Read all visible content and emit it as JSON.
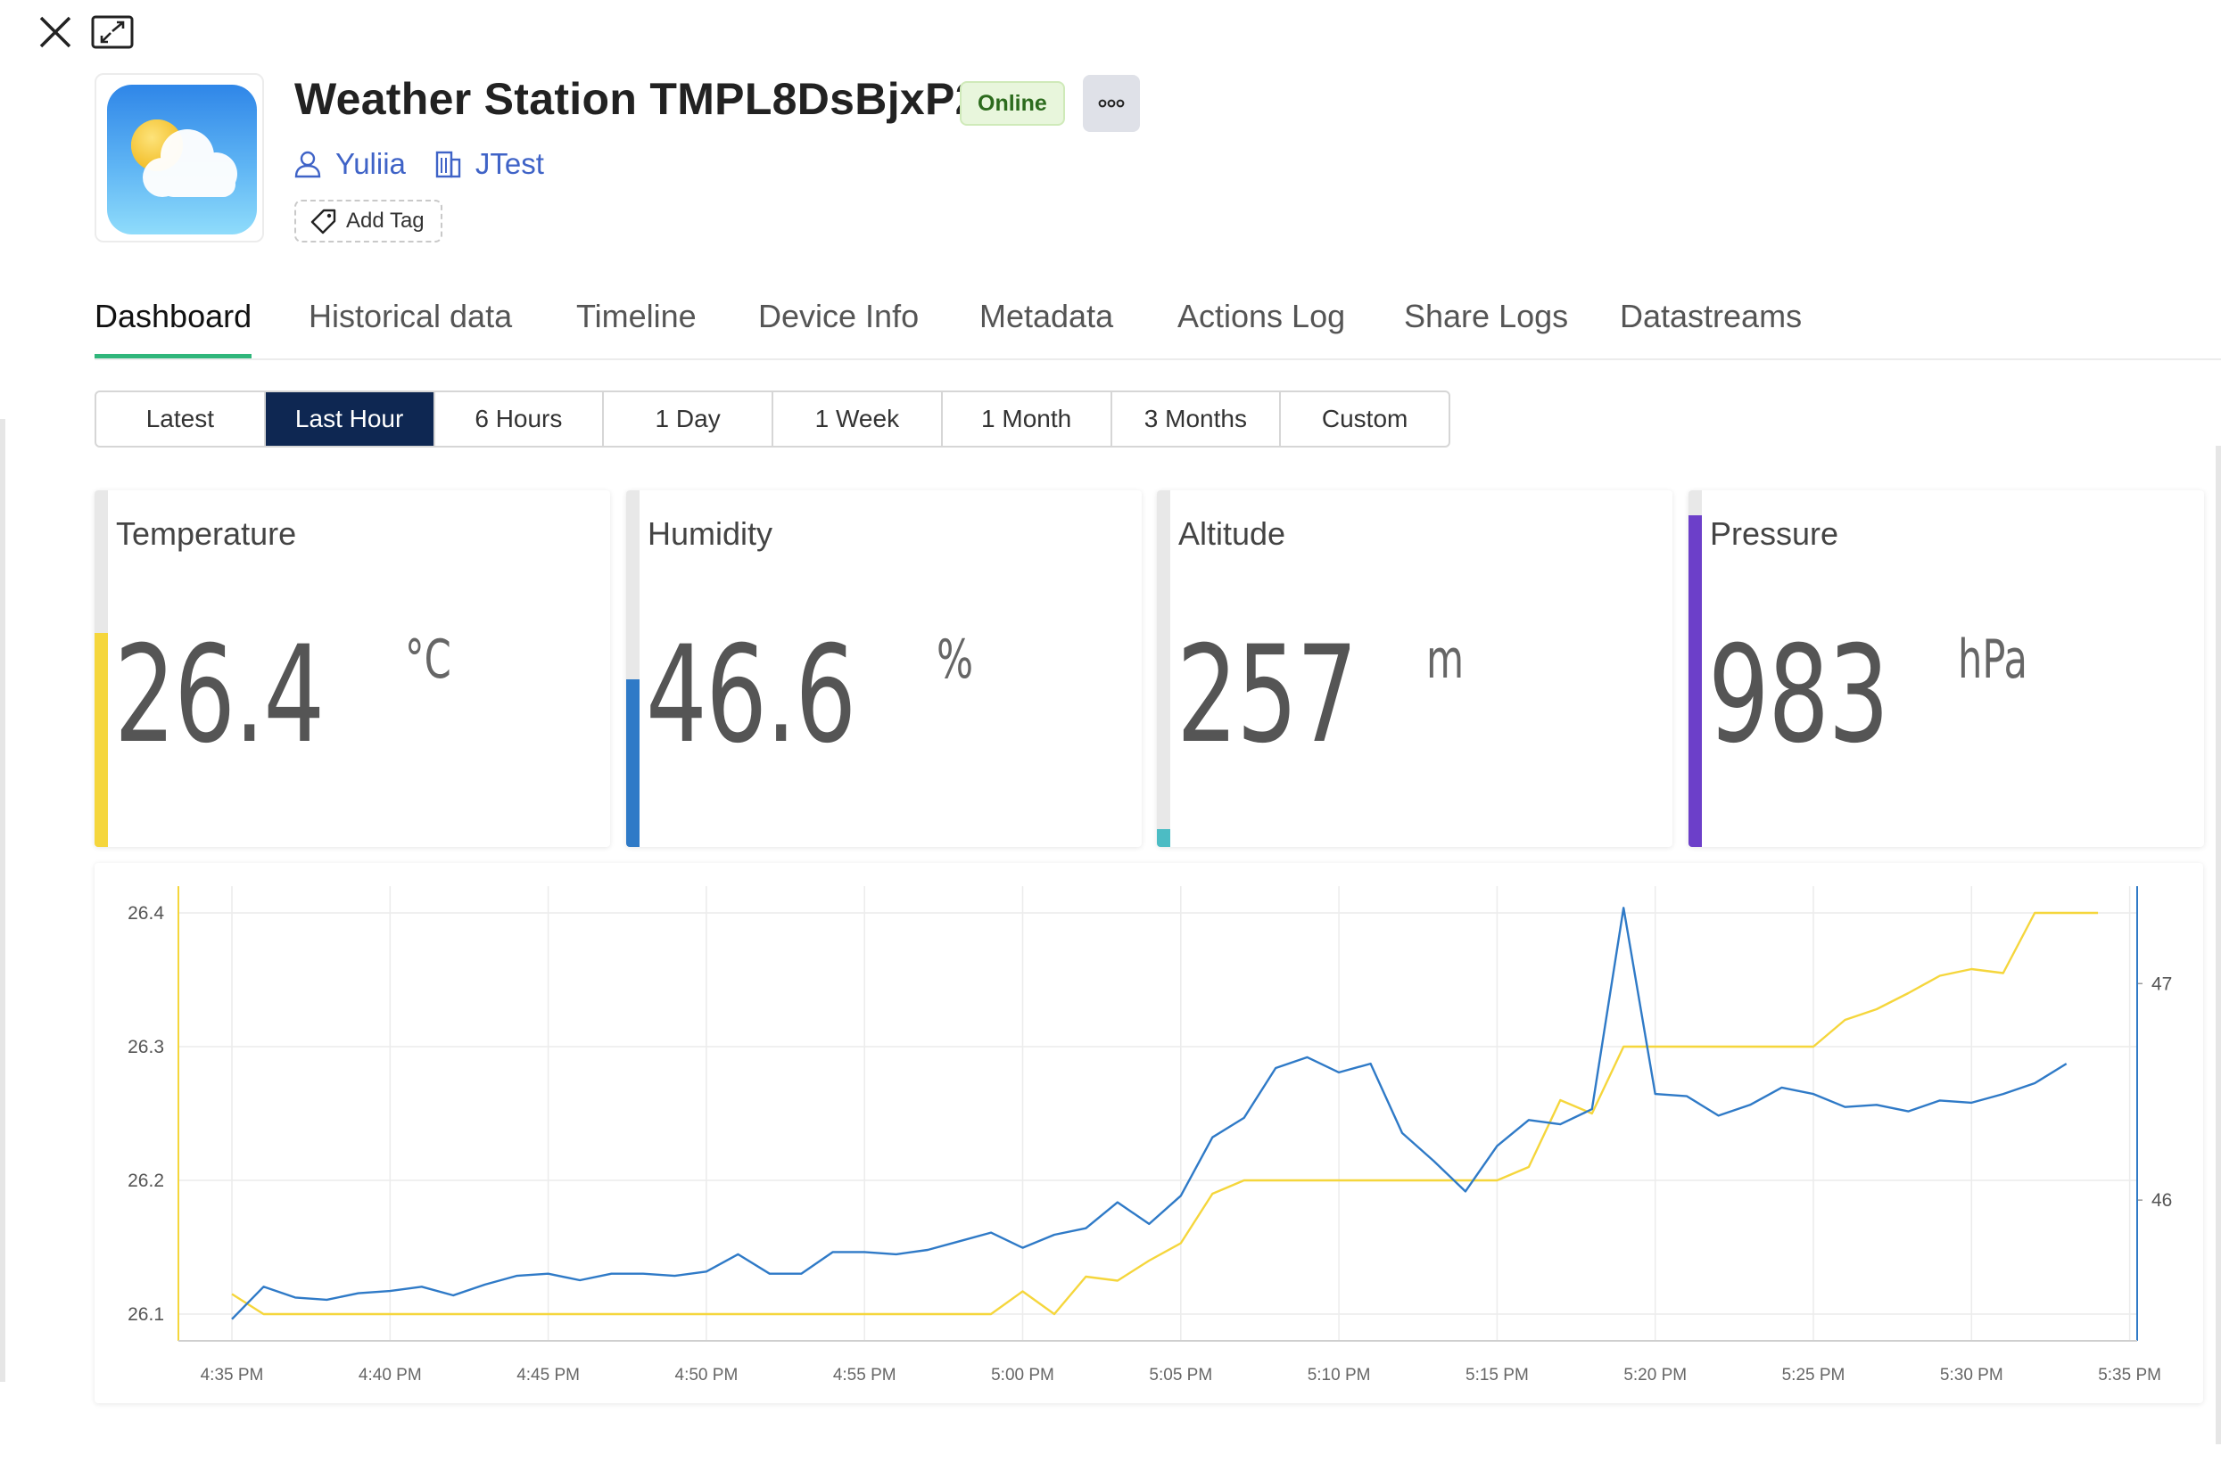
{
  "device": {
    "title": "Weather Station TMPL8DsBjxP2",
    "status": "Online",
    "owner": "Yuliia",
    "organization": "JTest",
    "add_tag_label": "Add Tag",
    "image_icon": "sun-cloud-icon"
  },
  "tabs": [
    "Dashboard",
    "Historical data",
    "Timeline",
    "Device Info",
    "Metadata",
    "Actions Log",
    "Share Logs",
    "Datastreams"
  ],
  "active_tab": "Dashboard",
  "time_ranges": [
    "Latest",
    "Last Hour",
    "6 Hours",
    "1 Day",
    "1 Week",
    "1 Month",
    "3 Months",
    "Custom"
  ],
  "active_range": "Last Hour",
  "widgets": [
    {
      "label": "Temperature",
      "value": "26.4",
      "unit": "°C",
      "color": "#f5d63c",
      "level": 0.6
    },
    {
      "label": "Humidity",
      "value": "46.6",
      "unit": "%",
      "color": "#2f7ac7",
      "level": 0.47
    },
    {
      "label": "Altitude",
      "value": "257",
      "unit": "m",
      "color": "#4cbcc4",
      "level": 0.05
    },
    {
      "label": "Pressure",
      "value": "983",
      "unit": "hPa",
      "color": "#6c3fc9",
      "level": 0.93
    }
  ],
  "chart_data": {
    "type": "line",
    "x_ticks": [
      "4:35 PM",
      "4:40 PM",
      "4:45 PM",
      "4:50 PM",
      "4:55 PM",
      "5:00 PM",
      "5:05 PM",
      "5:10 PM",
      "5:15 PM",
      "5:20 PM",
      "5:25 PM",
      "5:30 PM",
      "5:35 PM"
    ],
    "x_range_minutes": [
      0,
      60
    ],
    "left_axis": {
      "ticks": [
        "26.1",
        "26.2",
        "26.3",
        "26.4"
      ],
      "range": [
        26.08,
        26.42
      ],
      "color": "#f5d63c"
    },
    "right_axis": {
      "ticks": [
        "46",
        "47"
      ],
      "range": [
        45.35,
        47.45
      ],
      "color": "#2f7ac7"
    },
    "grid": true,
    "series": [
      {
        "axis": "left",
        "color": "#f5d63c",
        "points": [
          [
            0,
            26.115
          ],
          [
            1,
            26.1
          ],
          [
            2,
            26.1
          ],
          [
            3,
            26.1
          ],
          [
            4,
            26.1
          ],
          [
            5,
            26.1
          ],
          [
            6,
            26.1
          ],
          [
            7,
            26.1
          ],
          [
            8,
            26.1
          ],
          [
            9,
            26.1
          ],
          [
            10,
            26.1
          ],
          [
            11,
            26.1
          ],
          [
            12,
            26.1
          ],
          [
            13,
            26.1
          ],
          [
            14,
            26.1
          ],
          [
            15,
            26.1
          ],
          [
            16,
            26.1
          ],
          [
            17,
            26.1
          ],
          [
            18,
            26.1
          ],
          [
            19,
            26.1
          ],
          [
            20,
            26.1
          ],
          [
            21,
            26.1
          ],
          [
            22,
            26.1
          ],
          [
            23,
            26.1
          ],
          [
            24,
            26.1
          ],
          [
            25,
            26.117
          ],
          [
            26,
            26.1
          ],
          [
            27,
            26.128
          ],
          [
            28,
            26.125
          ],
          [
            29,
            26.14
          ],
          [
            30,
            26.153
          ],
          [
            31,
            26.19
          ],
          [
            32,
            26.2
          ],
          [
            33,
            26.2
          ],
          [
            34,
            26.2
          ],
          [
            35,
            26.2
          ],
          [
            36,
            26.2
          ],
          [
            37,
            26.2
          ],
          [
            38,
            26.2
          ],
          [
            39,
            26.2
          ],
          [
            40,
            26.2
          ],
          [
            41,
            26.21
          ],
          [
            42,
            26.26
          ],
          [
            43,
            26.25
          ],
          [
            44,
            26.3
          ],
          [
            45,
            26.3
          ],
          [
            46,
            26.3
          ],
          [
            47,
            26.3
          ],
          [
            48,
            26.3
          ],
          [
            49,
            26.3
          ],
          [
            50,
            26.3
          ],
          [
            51,
            26.32
          ],
          [
            52,
            26.328
          ],
          [
            53,
            26.34
          ],
          [
            54,
            26.353
          ],
          [
            55,
            26.358
          ],
          [
            56,
            26.355
          ],
          [
            57,
            26.4
          ],
          [
            58,
            26.4
          ],
          [
            59,
            26.4
          ]
        ]
      },
      {
        "axis": "right",
        "color": "#2f7ac7",
        "points": [
          [
            0,
            45.45
          ],
          [
            1,
            45.6
          ],
          [
            2,
            45.55
          ],
          [
            3,
            45.54
          ],
          [
            4,
            45.57
          ],
          [
            5,
            45.58
          ],
          [
            6,
            45.6
          ],
          [
            7,
            45.56
          ],
          [
            8,
            45.61
          ],
          [
            9,
            45.65
          ],
          [
            10,
            45.66
          ],
          [
            11,
            45.63
          ],
          [
            12,
            45.66
          ],
          [
            13,
            45.66
          ],
          [
            14,
            45.65
          ],
          [
            15,
            45.67
          ],
          [
            16,
            45.75
          ],
          [
            17,
            45.66
          ],
          [
            18,
            45.66
          ],
          [
            19,
            45.76
          ],
          [
            20,
            45.76
          ],
          [
            21,
            45.75
          ],
          [
            22,
            45.77
          ],
          [
            23,
            45.81
          ],
          [
            24,
            45.85
          ],
          [
            25,
            45.78
          ],
          [
            26,
            45.84
          ],
          [
            27,
            45.87
          ],
          [
            28,
            45.99
          ],
          [
            29,
            45.89
          ],
          [
            30,
            46.02
          ],
          [
            31,
            46.29
          ],
          [
            32,
            46.38
          ],
          [
            33,
            46.61
          ],
          [
            34,
            46.66
          ],
          [
            35,
            46.59
          ],
          [
            36,
            46.63
          ],
          [
            37,
            46.31
          ],
          [
            38,
            46.18
          ],
          [
            39,
            46.04
          ],
          [
            40,
            46.25
          ],
          [
            41,
            46.37
          ],
          [
            42,
            46.35
          ],
          [
            43,
            46.42
          ],
          [
            44,
            47.35
          ],
          [
            45,
            46.49
          ],
          [
            46,
            46.48
          ],
          [
            47,
            46.39
          ],
          [
            48,
            46.44
          ],
          [
            49,
            46.52
          ],
          [
            50,
            46.49
          ],
          [
            51,
            46.43
          ],
          [
            52,
            46.44
          ],
          [
            53,
            46.41
          ],
          [
            54,
            46.46
          ],
          [
            55,
            46.45
          ],
          [
            56,
            46.49
          ],
          [
            57,
            46.54
          ],
          [
            58,
            46.63
          ]
        ]
      }
    ]
  }
}
